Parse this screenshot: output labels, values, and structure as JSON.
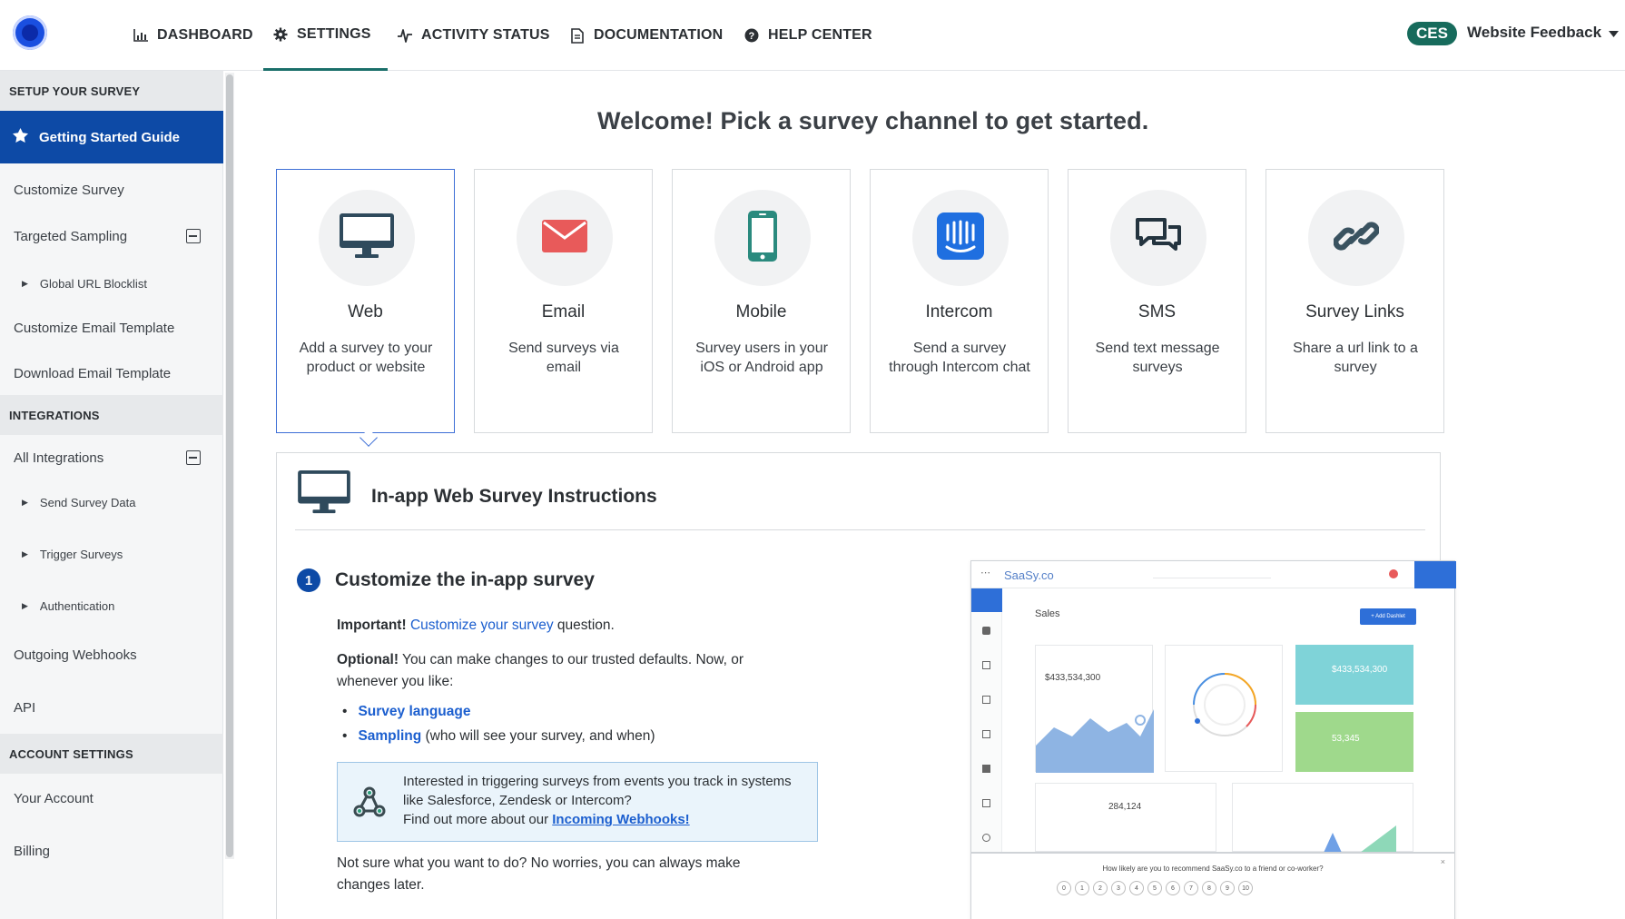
{
  "nav": {
    "items": [
      {
        "label": "DASHBOARD",
        "icon": "bar-chart-icon"
      },
      {
        "label": "SETTINGS",
        "icon": "gear-icon"
      },
      {
        "label": "ACTIVITY STATUS",
        "icon": "activity-icon"
      },
      {
        "label": "DOCUMENTATION",
        "icon": "document-icon"
      },
      {
        "label": "HELP CENTER",
        "icon": "help-icon"
      }
    ],
    "active": "SETTINGS",
    "badge": "CES",
    "workspace": "Website Feedback"
  },
  "sidebar": {
    "setup_header": "SETUP YOUR SURVEY",
    "getting_started": "Getting Started Guide",
    "customize_survey": "Customize Survey",
    "targeted_sampling": "Targeted Sampling",
    "global_url_blocklist": "Global URL Blocklist",
    "customize_email_template": "Customize Email Template",
    "download_email_template": "Download Email Template",
    "integrations_header": "INTEGRATIONS",
    "all_integrations": "All Integrations",
    "send_survey_data": "Send Survey Data",
    "trigger_surveys": "Trigger Surveys",
    "authentication": "Authentication",
    "outgoing_webhooks": "Outgoing Webhooks",
    "api": "API",
    "account_header": "ACCOUNT SETTINGS",
    "your_account": "Your Account",
    "billing": "Billing"
  },
  "main": {
    "welcome": "Welcome! Pick a survey channel to get started.",
    "channels": [
      {
        "title": "Web",
        "desc": "Add a survey to your product or website",
        "icon": "monitor-icon",
        "color": "#2f4a5c"
      },
      {
        "title": "Email",
        "desc": "Send surveys via email",
        "icon": "envelope-icon",
        "color": "#e85a5a"
      },
      {
        "title": "Mobile",
        "desc": "Survey users in your iOS or Android app",
        "icon": "mobile-phone-icon",
        "color": "#2a8a7e"
      },
      {
        "title": "Intercom",
        "desc": "Send a survey through Intercom chat",
        "icon": "intercom-icon",
        "color": "#1f6fe0"
      },
      {
        "title": "SMS",
        "desc": "Send text message surveys",
        "icon": "chat-bubbles-icon",
        "color": "#24343f"
      },
      {
        "title": "Survey Links",
        "desc": "Share a url link to a survey",
        "icon": "link-icon",
        "color": "#3a5360"
      }
    ],
    "selected_channel": "Web",
    "panel": {
      "title": "In-app Web Survey Instructions",
      "step_number": "1",
      "step_title": "Customize the in-app survey",
      "important_label": "Important!",
      "important_link": "Customize your survey",
      "important_rest": " question.",
      "optional_label": "Optional!",
      "optional_text": " You can make changes to our trusted defaults. Now, or whenever you like:",
      "bullets": [
        {
          "link": "Survey language",
          "rest": ""
        },
        {
          "link": "Sampling",
          "rest": " (who will see your survey, and when)"
        }
      ],
      "callout_text": "Interested in triggering surveys from events you track in systems like Salesforce, Zendesk or Intercom?",
      "callout_find": "Find out more about our ",
      "callout_link": "Incoming Webhooks!",
      "not_sure": "Not sure what you want to do? No worries, you can always make changes later."
    },
    "preview": {
      "brand": "SaaSy.co",
      "section": "Sales",
      "button": "+ Add Dashlet",
      "revenue": "$433,534,300",
      "revenue2": "$433,534,300",
      "orders": "53,345",
      "customers": "284,124",
      "question": "How likely are you to recommend SaaSy.co to a friend or co-worker?",
      "scale": [
        "0",
        "1",
        "2",
        "3",
        "4",
        "5",
        "6",
        "7",
        "8",
        "9",
        "10"
      ]
    }
  }
}
